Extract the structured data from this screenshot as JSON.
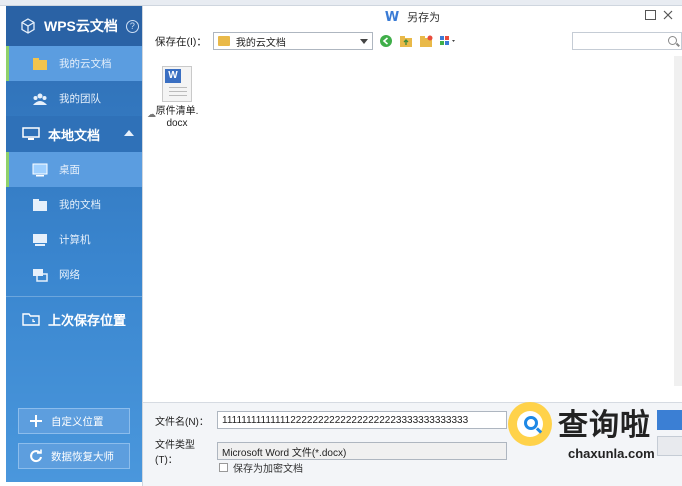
{
  "sidebar": {
    "header_title": "WPS云文档",
    "help_label": "?",
    "cloud_items": [
      {
        "label": "我的云文档",
        "icon": "cloud-folder-icon",
        "active": true
      },
      {
        "label": "我的团队",
        "icon": "team-icon",
        "active": false
      }
    ],
    "local_section": {
      "label": "本地文档",
      "icon": "monitor-icon"
    },
    "local_items": [
      {
        "label": "桌面",
        "icon": "desktop-icon",
        "active": true
      },
      {
        "label": "我的文档",
        "icon": "documents-folder-icon",
        "active": false
      },
      {
        "label": "计算机",
        "icon": "computer-icon",
        "active": false
      },
      {
        "label": "网络",
        "icon": "network-icon",
        "active": false
      }
    ],
    "last_location": {
      "label": "上次保存位置",
      "icon": "folder-history-icon"
    },
    "custom_location_button": "自定义位置",
    "recovery_button": "数据恢复大师"
  },
  "dialog": {
    "title": "另存为",
    "title_icon": "W",
    "save_in_label": "保存在(I)：",
    "save_in_value": "我的云文档",
    "search_placeholder": ""
  },
  "files": [
    {
      "name": "原件清单.docx",
      "line1": "原件清单.",
      "line2": "docx",
      "type": "word-doc"
    }
  ],
  "form": {
    "filename_label": "文件名(N)：",
    "filename_value": "1111111111111122222222222222222223333333333333",
    "filetype_label": "文件类型(T)：",
    "filetype_value": "Microsoft Word 文件(*.docx)",
    "encrypt_label": "保存为加密文档"
  },
  "watermark": {
    "cn": "查询啦",
    "en": "chaxunla.com"
  },
  "colors": {
    "sidebar_blue": "#3a86cf",
    "active_bar": "#8fd16a",
    "accent": "#3a7bd5"
  }
}
